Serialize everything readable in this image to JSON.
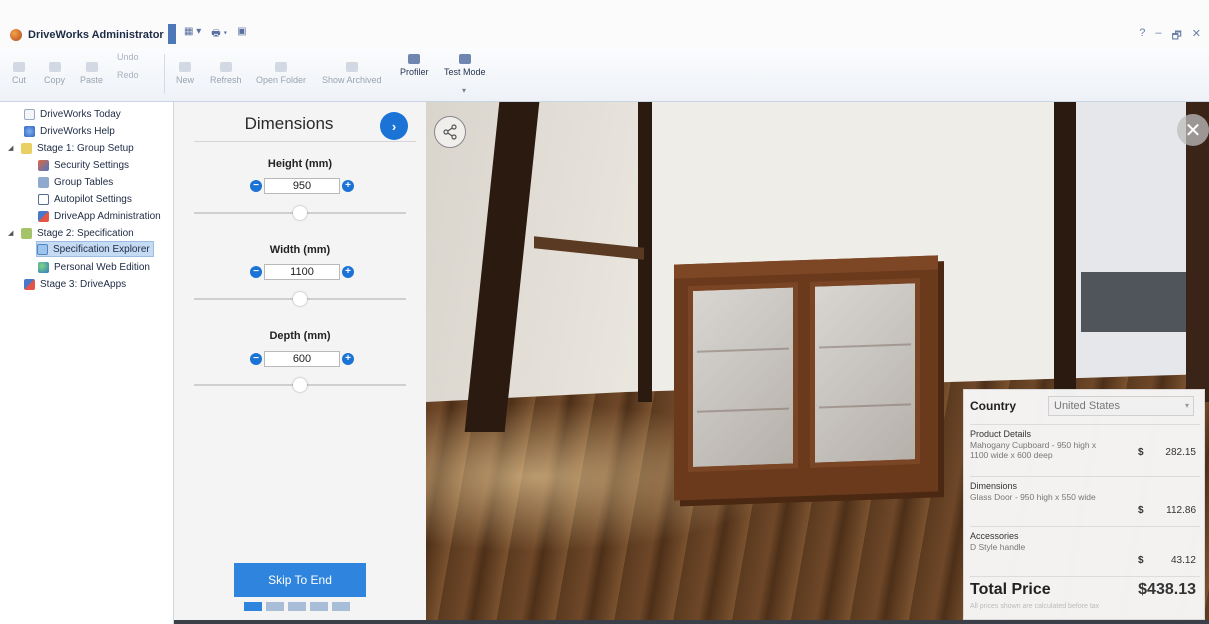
{
  "app": {
    "title": "DriveWorks Administrator",
    "window_controls": [
      "?",
      "–",
      "🗗",
      "✕"
    ],
    "quick_access": [
      "▦ ▾",
      "🖶 ▾",
      "▣"
    ]
  },
  "ribbon": {
    "clipboard": {
      "cut": "Cut",
      "copy": "Copy",
      "paste": "Paste",
      "undo": "Undo",
      "redo": "Redo"
    },
    "buttons": {
      "new": "New",
      "refresh": "Refresh",
      "open_folder": "Open Folder",
      "show_archived": "Show Archived",
      "profiler": "Profiler",
      "test_mode": "Test Mode"
    },
    "caret": "▾"
  },
  "tree": {
    "items": [
      {
        "label": "DriveWorks Today",
        "icon": "today-icon"
      },
      {
        "label": "DriveWorks Help",
        "icon": "help-icon"
      },
      {
        "label": "Stage 1: Group Setup",
        "icon": "stage-icon",
        "expander": "◢"
      },
      {
        "label": "Security Settings",
        "icon": "security-icon"
      },
      {
        "label": "Group Tables",
        "icon": "tables-icon"
      },
      {
        "label": "Autopilot Settings",
        "icon": "autopilot-icon"
      },
      {
        "label": "DriveApp Administration",
        "icon": "driveapp-icon"
      },
      {
        "label": "Stage 2: Specification",
        "icon": "stage-icon",
        "expander": "◢"
      },
      {
        "label": "Specification Explorer",
        "icon": "spec-explorer-icon"
      },
      {
        "label": "Personal Web Edition",
        "icon": "globe-icon"
      },
      {
        "label": "Stage 3: DriveApps",
        "icon": "driveapps-icon"
      }
    ]
  },
  "dimensions": {
    "title": "Dimensions",
    "next_glyph": "›",
    "minus_glyph": "−",
    "plus_glyph": "+",
    "fields": [
      {
        "label": "Height (mm)",
        "value": "950",
        "slider_fraction": 0.5
      },
      {
        "label": "Width (mm)",
        "value": "1100",
        "slider_fraction": 0.5
      },
      {
        "label": "Depth (mm)",
        "value": "600",
        "slider_fraction": 0.5
      }
    ],
    "skip_label": "Skip To End",
    "progress_steps": 5,
    "current_step": 1
  },
  "viewport": {
    "share_glyph": "⋖",
    "close_glyph": "✕"
  },
  "price": {
    "country_label": "Country",
    "country_value": "United States",
    "caret": "▾",
    "sections": [
      {
        "title": "Product Details",
        "desc": "Mahogany Cupboard - 950 high x 1100 wide x 600 deep",
        "currency": "$",
        "amount": "282.15"
      },
      {
        "title": "Dimensions",
        "desc": "Glass Door - 950 high x 550 wide",
        "currency": "$",
        "amount": "112.86"
      },
      {
        "title": "Accessories",
        "desc": "D Style handle",
        "currency": "$",
        "amount": "43.12"
      }
    ],
    "total_label": "Total Price",
    "total_value": "$438.13",
    "note": "All prices shown are calculated before tax"
  },
  "colors": {
    "accent": "#1b73d6",
    "skip_button": "#2f84dd",
    "tree_selected": "#c5daf3"
  }
}
